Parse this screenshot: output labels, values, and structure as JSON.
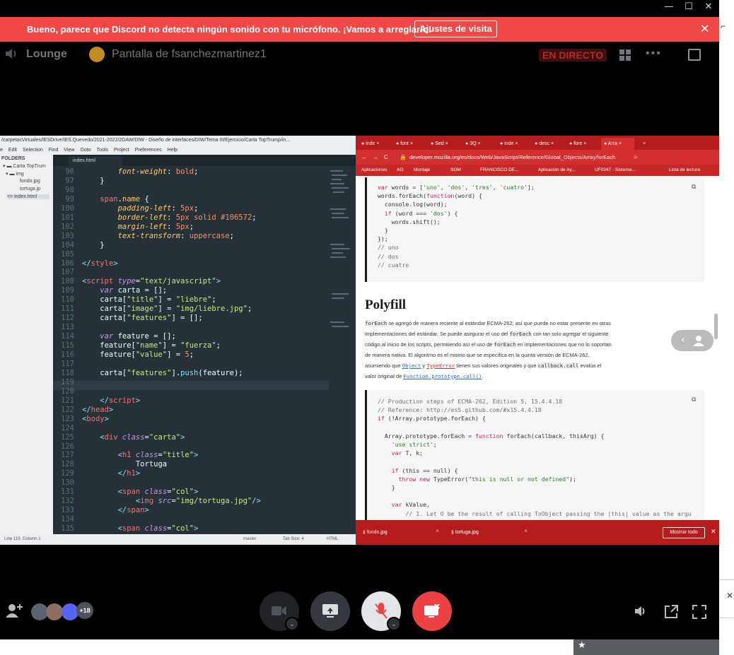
{
  "window": {
    "minimize": "—",
    "maximize": "☐",
    "close": "✕"
  },
  "notice": {
    "text": "Bueno, parece que Discord no detecta ningún sonido con tu micrófono. ¡Vamos a arreglarlo!",
    "button": "Ajustes de visita",
    "close": "✕"
  },
  "header": {
    "channel": "Lounge",
    "stream_name": "Pantalla de fsanchezmartinez1",
    "live_badge": "EN DIRECTO",
    "more": "•••"
  },
  "editor": {
    "title": "/carpetasVirtuales/IESDrive/IES.Quevedo/2021-2022/2DAW/DIW - Diseño de interfaces/DIW/Tema III/Ejercicio/Carta TopTrump/in...",
    "menu": [
      "e",
      "Edit",
      "Selection",
      "Find",
      "View",
      "Goto",
      "Tools",
      "Project",
      "Preferences",
      "Help"
    ],
    "sidebar": {
      "header": "FOLDERS",
      "items": [
        "Carta TopTrum",
        "img",
        "fondo.jpg",
        "tortuga.jp",
        "index.html"
      ]
    },
    "tab": "index.html",
    "status_left": "Line 119, Column 1",
    "status_branch": "master",
    "status_tab": "Tab Size: 4",
    "status_lang": "HTML",
    "lines": [
      {
        "n": "96",
        "html": "        <span class='a k'>font-weight</span>: <span class='n'>bold</span>;"
      },
      {
        "n": "97",
        "html": "    }"
      },
      {
        "n": "98",
        "html": ""
      },
      {
        "n": "99",
        "html": "    <span class='t'>span</span>.<span class='a'>name</span> {"
      },
      {
        "n": "100",
        "html": "        <span class='a k'>padding-left</span>: <span class='n'>5px</span>;"
      },
      {
        "n": "101",
        "html": "        <span class='a k'>border-left</span>: <span class='n'>5px</span> <span class='n'>solid</span> <span class='n'>#106572</span>;"
      },
      {
        "n": "102",
        "html": "        <span class='a k'>margin-left</span>: <span class='n'>5px</span>;"
      },
      {
        "n": "103",
        "html": "        <span class='a k'>text-transform</span>: <span class='n'>uppercase</span>;"
      },
      {
        "n": "104",
        "html": "    }"
      },
      {
        "n": "105",
        "html": ""
      },
      {
        "n": "106",
        "html": "<span class='p'>&lt;/</span><span class='t'>style</span><span class='p'>&gt;</span>"
      },
      {
        "n": "107",
        "html": ""
      },
      {
        "n": "108",
        "html": "<span class='p'>&lt;</span><span class='t'>script</span> <span class='k'>type</span>=<span class='s'>\"text/javascript\"</span><span class='p'>&gt;</span>"
      },
      {
        "n": "109",
        "html": "    <span class='k'>var</span> carta = [];"
      },
      {
        "n": "110",
        "html": "    carta[<span class='s'>\"title\"</span>] = <span class='s'>\"liebre\"</span>;"
      },
      {
        "n": "111",
        "html": "    carta[<span class='s'>\"image\"</span>] = <span class='s'>\"img/liebre.jpg\"</span>;"
      },
      {
        "n": "112",
        "html": "    carta[<span class='s'>\"features\"</span>] = [];"
      },
      {
        "n": "113",
        "html": ""
      },
      {
        "n": "114",
        "html": "    <span class='k'>var</span> feature = [];"
      },
      {
        "n": "115",
        "html": "    feature[<span class='s'>\"name\"</span>] = <span class='s'>\"fuerza\"</span>;"
      },
      {
        "n": "116",
        "html": "    feature[<span class='s'>\"value\"</span>] = <span class='n'>5</span>;"
      },
      {
        "n": "117",
        "html": ""
      },
      {
        "n": "118",
        "html": "    carta[<span class='s'>\"features\"</span>].<span class='p'>push</span>(feature);"
      },
      {
        "n": "119",
        "html": ""
      },
      {
        "n": "120",
        "html": ""
      },
      {
        "n": "121",
        "html": "    <span class='p'>&lt;/</span><span class='t'>script</span><span class='p'>&gt;</span>"
      },
      {
        "n": "122",
        "html": "<span class='p'>&lt;/</span><span class='t'>head</span><span class='p'>&gt;</span>"
      },
      {
        "n": "123",
        "html": "<span class='p'>&lt;</span><span class='t'>body</span><span class='p'>&gt;</span>"
      },
      {
        "n": "124",
        "html": ""
      },
      {
        "n": "125",
        "html": "    <span class='p'>&lt;</span><span class='t'>div</span> <span class='k'>class</span>=<span class='s'>\"carta\"</span><span class='p'>&gt;</span>"
      },
      {
        "n": "126",
        "html": ""
      },
      {
        "n": "127",
        "html": "        <span class='p'>&lt;</span><span class='t'>h1</span> <span class='k'>class</span>=<span class='s'>\"title\"</span><span class='p'>&gt;</span>"
      },
      {
        "n": "128",
        "html": "            Tortuga"
      },
      {
        "n": "129",
        "html": "        <span class='p'>&lt;/</span><span class='t'>h1</span><span class='p'>&gt;</span>"
      },
      {
        "n": "130",
        "html": ""
      },
      {
        "n": "131",
        "html": "        <span class='p'>&lt;</span><span class='t'>span</span> <span class='k'>class</span>=<span class='s'>\"col\"</span><span class='p'>&gt;</span>"
      },
      {
        "n": "132",
        "html": "            <span class='p'>&lt;</span><span class='t'>img</span> <span class='k'>src</span>=<span class='s'>\"img/tortuga.jpg\"</span><span class='p'>/&gt;</span>"
      },
      {
        "n": "133",
        "html": "        <span class='p'>&lt;/</span><span class='t'>span</span><span class='p'>&gt;</span>"
      },
      {
        "n": "134",
        "html": ""
      },
      {
        "n": "135",
        "html": "        <span class='p'>&lt;</span><span class='t'>span</span> <span class='k'>class</span>=<span class='s'>\"col\"</span><span class='p'>&gt;</span>"
      }
    ]
  },
  "browser": {
    "tabs": [
      "inde",
      "font",
      "Sed",
      "3Q",
      "inde",
      "desc",
      "fore",
      "Arra"
    ],
    "new_tab": "+",
    "url": "developer.mozilla.org/es/docs/Web/JavaScript/Reference/Global_Objects/Array/forEach",
    "bookmarks": [
      "Aplicaciones",
      "AO",
      "Montaje",
      "SOM",
      "FRANCISCO DE...",
      "Aplicación de Ay...",
      "UF0347 - Sistema...",
      "Lista de lectura"
    ],
    "code1": [
      "var words = ['uno', 'dos', 'tres', 'cuatro'];",
      "words.forEach(function(word) {",
      "  console.log(word);",
      "  if (word === 'dos') {",
      "    words.shift();",
      "  }",
      "});",
      "// uno",
      "// dos",
      "// cuatro"
    ],
    "polyfill_title": "Polyfill",
    "para": {
      "l1a": "forEach",
      "l1b": " se agregó de manera reciente al estándar ECMA-262; así que puede no estar presente en otras",
      "l2a": "implementaciones del estándar. Se puede asegurar el uso del ",
      "l2b": "forEach",
      "l2c": " con tan solo agregar el siguiente",
      "l3a": "código al inicio de los scripts, permitiendo así el uso de ",
      "l3b": "forEach",
      "l3c": " en implementaciones que no lo soportan",
      "l4": "de manera nativa. El algoritmo es el mismo que se especifica en la quinta versión de ECMA-262,",
      "l5a": "asumiendo que ",
      "l5b": "Object",
      "l5c": " y ",
      "l5d": "TypeError",
      "l5e": " tienen sus valores originales y que ",
      "l5f": "callback.call",
      "l5g": " evalúa el",
      "l6a": "valor original de ",
      "l6b": "Function.prototype.call()",
      "l6c": "."
    },
    "code2": [
      "// Production steps of ECMA-262, Edition 5, 15.4.4.18",
      "// Reference: http://es5.github.com/#x15.4.4.18",
      "if (!Array.prototype.forEach) {",
      "",
      "  Array.prototype.forEach = function forEach(callback, thisArg) {",
      "    'use strict';",
      "    var T, k;",
      "",
      "    if (this == null) {",
      "      throw new TypeError(\"this is null or not defined\");",
      "    }",
      "",
      "    var kValue,",
      "        // 1. Let O be the result of calling ToObject passing the |this| value as the argu"
    ],
    "downloads": [
      "fondo.jpg",
      "tortuga.jpg"
    ],
    "show_all": "Mostrar todo"
  },
  "controls": {
    "participants_more": "+18"
  },
  "colors": {
    "notice": "#f04747",
    "discord_bg": "#000000",
    "editor_bg": "#263238",
    "browser_accent": "#d32f2f",
    "leave": "#ed4245"
  }
}
